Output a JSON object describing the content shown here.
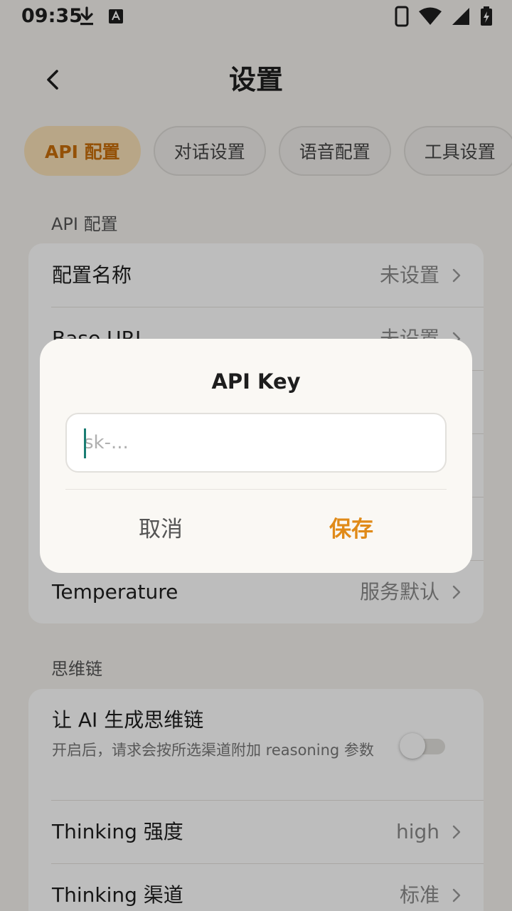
{
  "status_bar": {
    "time": "09:35"
  },
  "header": {
    "title": "设置"
  },
  "tabs": [
    {
      "label": "API 配置",
      "active": true
    },
    {
      "label": "对话设置",
      "active": false
    },
    {
      "label": "语音配置",
      "active": false
    },
    {
      "label": "工具设置",
      "active": false
    }
  ],
  "sections": {
    "api": {
      "label": "API 配置",
      "rows": [
        {
          "label": "配置名称",
          "value": "未设置"
        },
        {
          "label": "Base URL",
          "value": "未设置"
        },
        {
          "label": "Temperature",
          "value": "服务默认"
        }
      ]
    },
    "reasoning": {
      "label": "思维链",
      "toggle_row": {
        "label": "让 AI 生成思维链",
        "description": "开启后，请求会按所选渠道附加 reasoning 参数",
        "enabled": false
      },
      "rows": [
        {
          "label": "Thinking 强度",
          "value": "high"
        },
        {
          "label": "Thinking 渠道",
          "value": "标准"
        }
      ]
    }
  },
  "dialog": {
    "title": "API Key",
    "input_value": "",
    "input_placeholder": "sk-...",
    "cancel_label": "取消",
    "save_label": "保存"
  },
  "colors": {
    "accent": "#e08a18",
    "tab_active_bg": "#f8e1b6",
    "tab_active_text": "#c86e0a",
    "caret": "#1a7d73"
  }
}
